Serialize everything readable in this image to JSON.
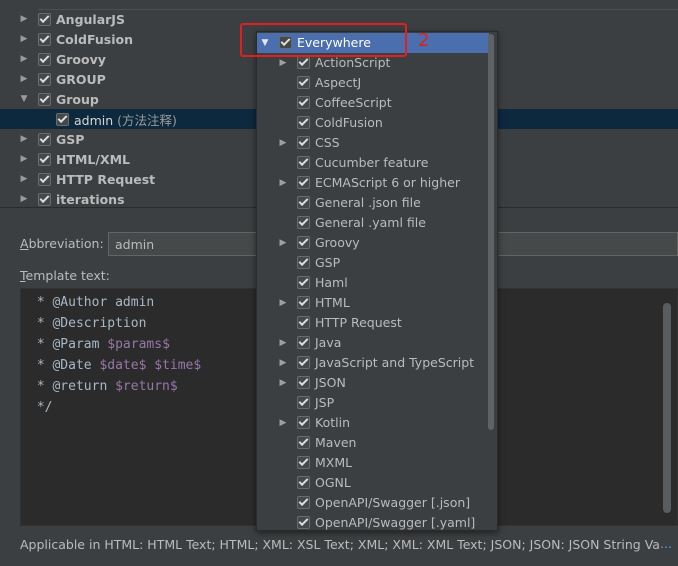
{
  "tree": {
    "groups": [
      {
        "label": "AngularJS",
        "expanded": false,
        "checked": true
      },
      {
        "label": "ColdFusion",
        "expanded": false,
        "checked": true
      },
      {
        "label": "Groovy",
        "expanded": false,
        "checked": true
      },
      {
        "label": "GROUP",
        "expanded": false,
        "checked": true
      },
      {
        "label": "Group",
        "expanded": true,
        "checked": true
      },
      {
        "label": "GSP",
        "expanded": false,
        "checked": true
      },
      {
        "label": "HTML/XML",
        "expanded": false,
        "checked": true
      },
      {
        "label": "HTTP Request",
        "expanded": false,
        "checked": true
      },
      {
        "label": "iterations",
        "expanded": false,
        "checked": true
      }
    ],
    "selected_child": {
      "label": "admin",
      "description": "(方法注释)",
      "checked": true
    }
  },
  "abbreviation": {
    "label_prefix": "A",
    "label_rest": "bbreviation:",
    "value": "admin"
  },
  "template": {
    "label_prefix": "T",
    "label_rest": "emplate text:",
    "lines": [
      {
        "plain": " * @Author admin",
        "var": ""
      },
      {
        "plain": " * @Description",
        "var": ""
      },
      {
        "plain": " * @Param ",
        "var": "$params$"
      },
      {
        "plain": " * @Date ",
        "var": "$date$ $time$"
      },
      {
        "plain": " * @return ",
        "var": "$return$"
      },
      {
        "plain": " */",
        "var": ""
      }
    ]
  },
  "applicable": {
    "text": "Applicable in HTML: HTML Text; HTML; XML: XSL Text; XML; XML: XML Text; JSON; JSON: JSON String Valu...",
    "more": "..."
  },
  "popup": {
    "items": [
      {
        "label": "Everywhere",
        "arrow": "down",
        "checked": true,
        "selected": true
      },
      {
        "label": "ActionScript",
        "arrow": "right",
        "checked": true
      },
      {
        "label": "AspectJ",
        "arrow": "",
        "checked": true
      },
      {
        "label": "CoffeeScript",
        "arrow": "",
        "checked": true
      },
      {
        "label": "ColdFusion",
        "arrow": "",
        "checked": true
      },
      {
        "label": "CSS",
        "arrow": "right",
        "checked": true
      },
      {
        "label": "Cucumber feature",
        "arrow": "",
        "checked": true
      },
      {
        "label": "ECMAScript 6 or higher",
        "arrow": "right",
        "checked": true
      },
      {
        "label": "General .json file",
        "arrow": "",
        "checked": true
      },
      {
        "label": "General .yaml file",
        "arrow": "",
        "checked": true
      },
      {
        "label": "Groovy",
        "arrow": "right",
        "checked": true
      },
      {
        "label": "GSP",
        "arrow": "",
        "checked": true
      },
      {
        "label": "Haml",
        "arrow": "",
        "checked": true
      },
      {
        "label": "HTML",
        "arrow": "right",
        "checked": true
      },
      {
        "label": "HTTP Request",
        "arrow": "",
        "checked": true
      },
      {
        "label": "Java",
        "arrow": "right",
        "checked": true
      },
      {
        "label": "JavaScript and TypeScript",
        "arrow": "right",
        "checked": true
      },
      {
        "label": "JSON",
        "arrow": "right",
        "checked": true
      },
      {
        "label": "JSP",
        "arrow": "",
        "checked": true
      },
      {
        "label": "Kotlin",
        "arrow": "right",
        "checked": true
      },
      {
        "label": "Maven",
        "arrow": "",
        "checked": true
      },
      {
        "label": "MXML",
        "arrow": "",
        "checked": true
      },
      {
        "label": "OGNL",
        "arrow": "",
        "checked": true
      },
      {
        "label": "OpenAPI/Swagger [.json]",
        "arrow": "",
        "checked": true
      },
      {
        "label": "OpenAPI/Swagger [.yaml]",
        "arrow": "",
        "checked": true
      }
    ]
  },
  "annotation": {
    "number": "2",
    "color": "#e02020"
  },
  "colors": {
    "background": "#3c3f41",
    "editor_bg": "#2b2b2b",
    "selection_blue": "#4b6eaf",
    "tree_selection": "#0d293e",
    "template_var": "#9876aa"
  }
}
